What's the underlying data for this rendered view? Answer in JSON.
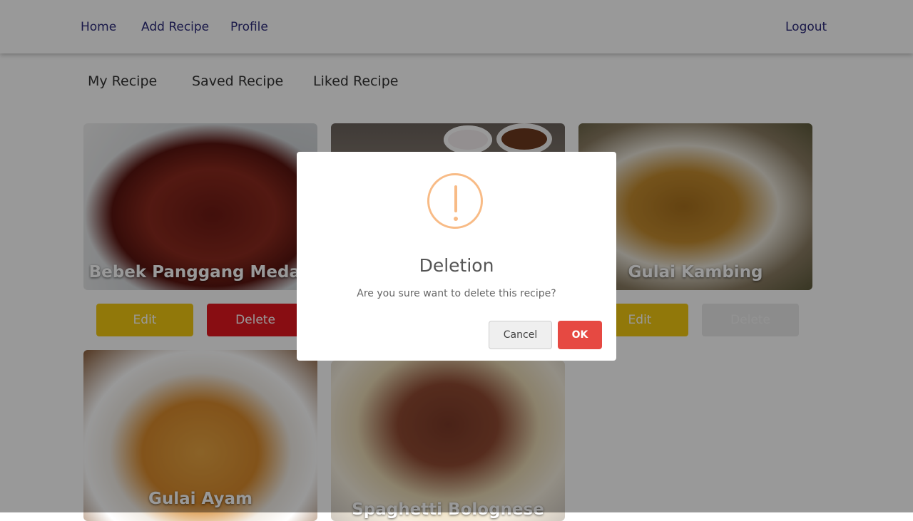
{
  "nav": {
    "home": "Home",
    "add_recipe": "Add Recipe",
    "profile": "Profile",
    "logout": "Logout"
  },
  "tabs": [
    "My Recipe",
    "Saved Recipe",
    "Liked Recipe"
  ],
  "recipes": [
    {
      "title": "Bebek Panggang Medan",
      "edit": "Edit",
      "delete": "Delete"
    },
    {
      "title": "",
      "edit": "",
      "delete": ""
    },
    {
      "title": "Gulai Kambing",
      "edit": "Edit",
      "delete": "Delete"
    },
    {
      "title": "Gulai Ayam"
    },
    {
      "title": "Spaghetti Bolognese"
    }
  ],
  "modal": {
    "icon": "warning-icon",
    "title": "Deletion",
    "message": "Are you sure want to delete this recipe?",
    "cancel": "Cancel",
    "ok": "OK"
  },
  "colors": {
    "nav_link": "#2c2a7a",
    "edit": "#f2c811",
    "delete": "#e3161f",
    "ok": "#e64942",
    "warning": "#f8bb86"
  }
}
